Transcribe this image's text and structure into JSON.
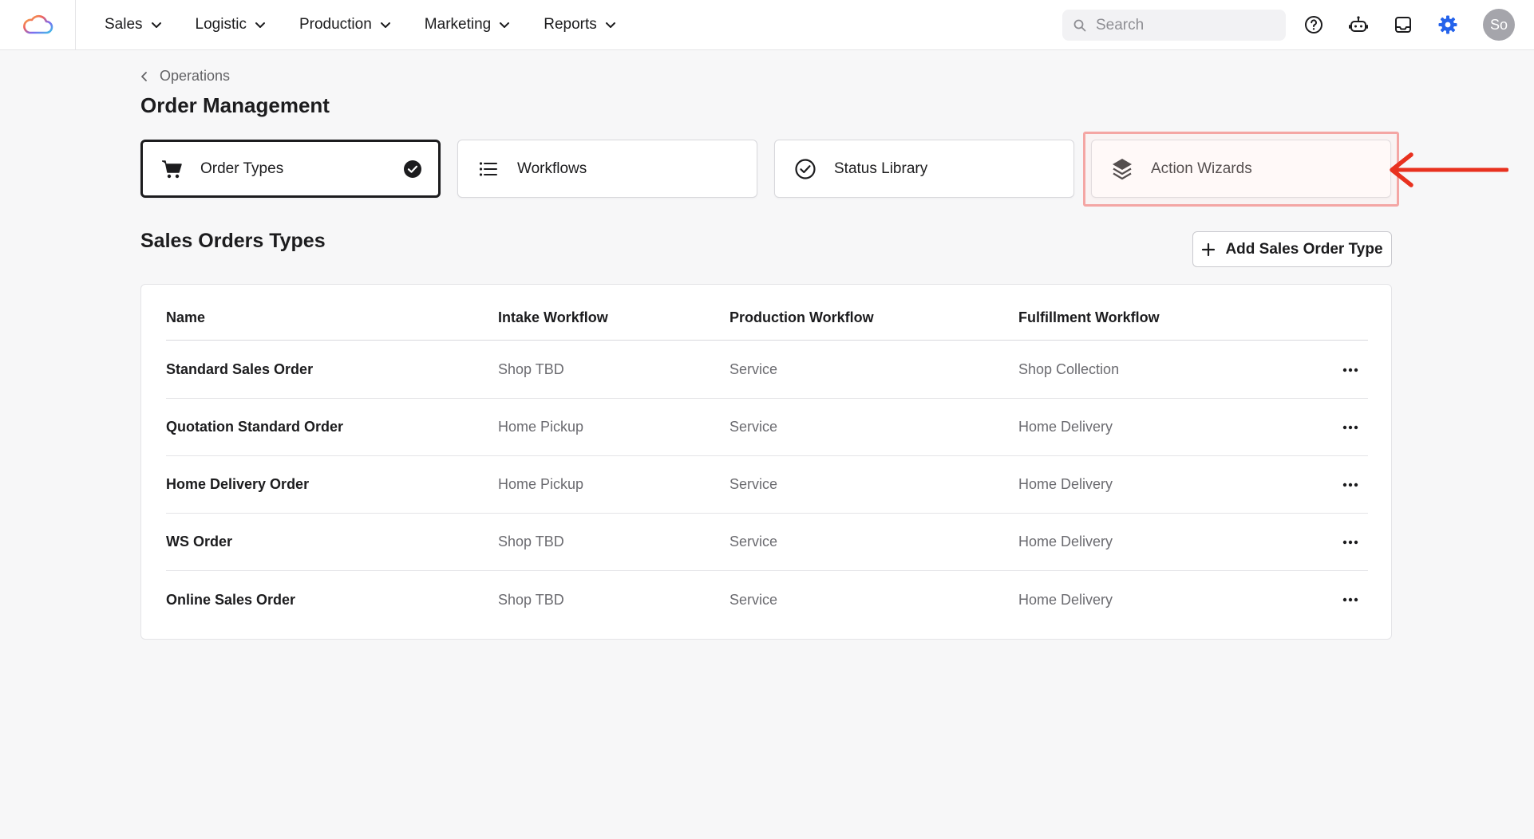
{
  "nav": {
    "items": [
      {
        "label": "Sales"
      },
      {
        "label": "Logistic"
      },
      {
        "label": "Production"
      },
      {
        "label": "Marketing"
      },
      {
        "label": "Reports"
      }
    ],
    "search_placeholder": "Search",
    "avatar_initials": "So",
    "accent_color": "#2563eb"
  },
  "breadcrumb": {
    "label": "Operations"
  },
  "page": {
    "title": "Order Management"
  },
  "tabs": [
    {
      "label": "Order Types",
      "icon": "cart-icon",
      "active": true
    },
    {
      "label": "Workflows",
      "icon": "list-icon",
      "active": false
    },
    {
      "label": "Status Library",
      "icon": "check-circle-icon",
      "active": false
    },
    {
      "label": "Action Wizards",
      "icon": "layers-icon",
      "active": false
    }
  ],
  "section": {
    "title": "Sales Orders Types",
    "add_button_label": "Add Sales Order Type"
  },
  "table": {
    "columns": [
      "Name",
      "Intake Workflow",
      "Production Workflow",
      "Fulfillment Workflow"
    ],
    "rows": [
      {
        "name": "Standard Sales Order",
        "intake": "Shop TBD",
        "production": "Service",
        "fulfillment": "Shop Collection"
      },
      {
        "name": "Quotation Standard Order",
        "intake": "Home Pickup",
        "production": "Service",
        "fulfillment": "Home Delivery"
      },
      {
        "name": "Home Delivery Order",
        "intake": "Home Pickup",
        "production": "Service",
        "fulfillment": "Home Delivery"
      },
      {
        "name": "WS Order",
        "intake": "Shop TBD",
        "production": "Service",
        "fulfillment": "Home Delivery"
      },
      {
        "name": "Online Sales Order",
        "intake": "Shop TBD",
        "production": "Service",
        "fulfillment": "Home Delivery"
      }
    ]
  },
  "annotation": {
    "highlight_color": "#f4a6a4",
    "arrow_color": "#e8311f"
  }
}
